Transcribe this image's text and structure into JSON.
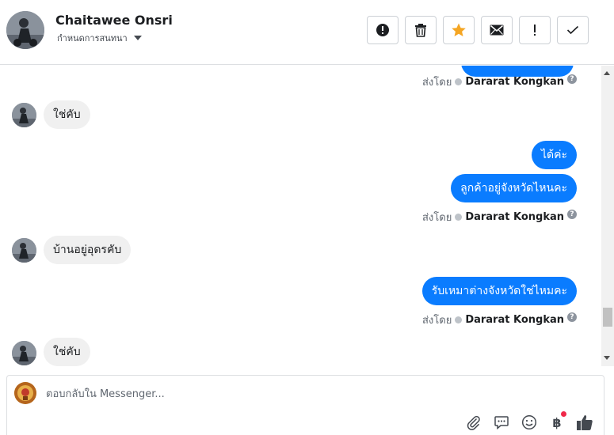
{
  "header": {
    "name": "Chaitawee Onsri",
    "label_dropdown": "กำหนดการสนทนา"
  },
  "toolbar": {
    "items": [
      {
        "name": "mark-spam",
        "icon": "alert-circle-icon"
      },
      {
        "name": "delete",
        "icon": "trash-icon"
      },
      {
        "name": "star",
        "icon": "star-icon",
        "color": "#f5a623"
      },
      {
        "name": "mark-unread",
        "icon": "envelope-icon"
      },
      {
        "name": "follow-up",
        "icon": "exclamation-icon"
      },
      {
        "name": "mark-done",
        "icon": "check-icon"
      }
    ]
  },
  "messages": [
    {
      "type": "sentby",
      "label": "ส่งโดย",
      "author": "Dararat Kongkan"
    },
    {
      "type": "in",
      "text": "ใช่คับ"
    },
    {
      "type": "out",
      "text": "ได้ค่ะ"
    },
    {
      "type": "out",
      "text": "ลูกค้าอยู่จังหวัดไหนคะ"
    },
    {
      "type": "sentby",
      "label": "ส่งโดย",
      "author": "Dararat Kongkan"
    },
    {
      "type": "in",
      "text": "บ้านอยู่อุดรคับ"
    },
    {
      "type": "out",
      "text": "รับเหมาต่างจังหวัดใช่ไหมคะ"
    },
    {
      "type": "sentby",
      "label": "ส่งโดย",
      "author": "Dararat Kongkan"
    },
    {
      "type": "in",
      "text": "ใช่คับ"
    }
  ],
  "composer": {
    "placeholder": "ตอบกลับใน Messenger...",
    "value": ""
  },
  "colors": {
    "outgoing_bubble": "#0a7cff",
    "incoming_bubble": "#f0f0f0",
    "star": "#f5a623",
    "notification_dot": "#f02849"
  }
}
